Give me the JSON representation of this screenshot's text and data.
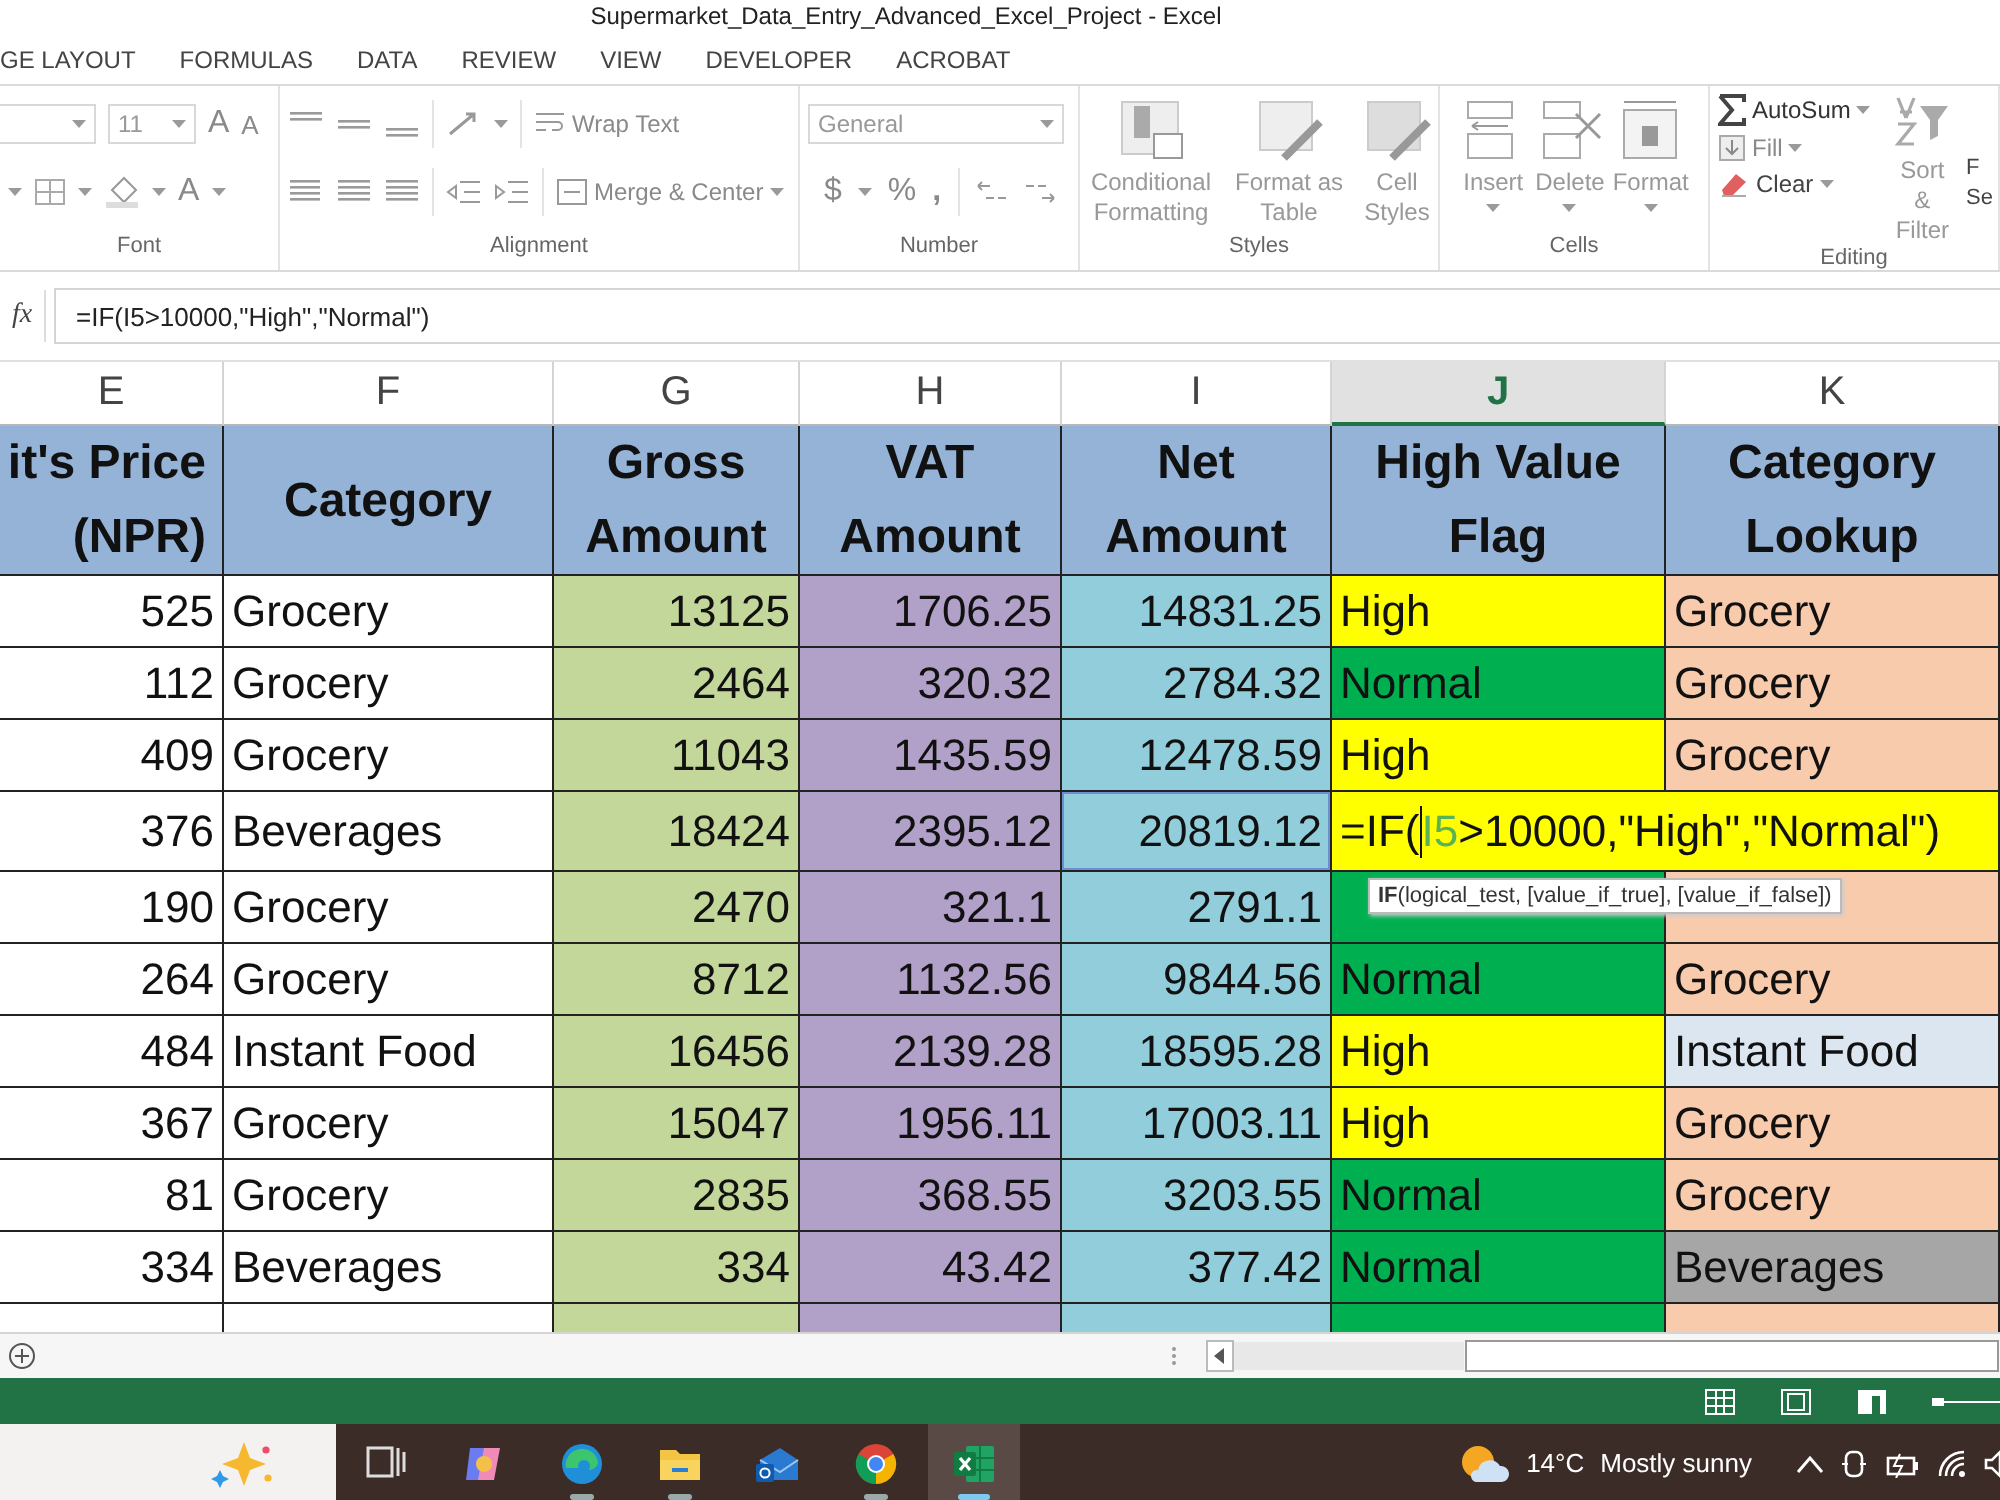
{
  "window": {
    "title": "Supermarket_Data_Entry_Advanced_Excel_Project - Excel"
  },
  "tabs": [
    {
      "label": "GE LAYOUT",
      "selected": false
    },
    {
      "label": "FORMULAS",
      "selected": false
    },
    {
      "label": "DATA",
      "selected": false
    },
    {
      "label": "REVIEW",
      "selected": false
    },
    {
      "label": "VIEW",
      "selected": false
    },
    {
      "label": "DEVELOPER",
      "selected": false
    },
    {
      "label": "ACROBAT",
      "selected": false
    }
  ],
  "ribbon": {
    "groups": [
      {
        "kind": "font",
        "label": "Font",
        "size": "11",
        "grow": "A",
        "shrink": "A",
        "font_color": "A"
      },
      {
        "kind": "alignment",
        "label": "Alignment",
        "wrap": "Wrap Text",
        "merge": "Merge & Center"
      },
      {
        "kind": "number",
        "label": "Number",
        "format": "General",
        "currency": "$",
        "percent": "%",
        "comma": ","
      },
      {
        "kind": "styles",
        "label": "Styles",
        "buttons": [
          "Conditional Formatting",
          "Format as Table",
          "Cell Styles"
        ]
      },
      {
        "kind": "cells",
        "label": "Cells",
        "buttons": [
          "Insert",
          "Delete",
          "Format"
        ]
      },
      {
        "kind": "editing",
        "label": "Editing",
        "autosum": "AutoSum",
        "fill": "Fill",
        "clear": "Clear",
        "sort": "Sort & Filter",
        "find": "F Se"
      }
    ]
  },
  "formula_bar": {
    "function_label": "fx",
    "formula": "=IF(I5>10000,\"High\",\"Normal\")"
  },
  "columns": [
    {
      "label": "E",
      "selected": false
    },
    {
      "label": "F",
      "selected": false
    },
    {
      "label": "G",
      "selected": false
    },
    {
      "label": "H",
      "selected": false
    },
    {
      "label": "I",
      "selected": false
    },
    {
      "label": "J",
      "selected": true
    },
    {
      "label": "K",
      "selected": false
    }
  ],
  "headers": [
    "it's Price (NPR)",
    "Category",
    "Gross Amount",
    "VAT Amount",
    "Net Amount",
    "High Value Flag",
    "Category Lookup"
  ],
  "rows": [
    {
      "kind": "data",
      "price": "525",
      "category": "Grocery",
      "gross": "13125",
      "vat": "1706.25",
      "net": "14831.25",
      "flag": {
        "text": "High",
        "color": "#ffff00"
      },
      "lookup": {
        "text": "Grocery",
        "color": "#f8cbad"
      }
    },
    {
      "kind": "data",
      "price": "112",
      "category": "Grocery",
      "gross": "2464",
      "vat": "320.32",
      "net": "2784.32",
      "flag": {
        "text": "Normal",
        "color": "#00b050"
      },
      "lookup": {
        "text": "Grocery",
        "color": "#f8cbad"
      }
    },
    {
      "kind": "data",
      "price": "409",
      "category": "Grocery",
      "gross": "11043",
      "vat": "1435.59",
      "net": "12478.59",
      "flag": {
        "text": "High",
        "color": "#ffff00"
      },
      "lookup": {
        "text": "Grocery",
        "color": "#f8cbad"
      }
    },
    {
      "kind": "editing",
      "price": "376",
      "category": "Beverages",
      "gross": "18424",
      "vat": "2395.12",
      "net": "20819.12",
      "flag": {
        "color": "#ffff00"
      },
      "formula": [
        {
          "kind": "plain",
          "text": "=IF("
        },
        {
          "kind": "ref",
          "text": "I5"
        },
        {
          "kind": "plain",
          "text": ">10000,\"High\",\"Normal\")"
        }
      ],
      "tooltip": "**IF**(logical_test, [value_if_true], [value_if_false])"
    },
    {
      "kind": "data",
      "price": "190",
      "category": "Grocery",
      "gross": "2470",
      "vat": "321.1",
      "net": "2791.1",
      "flag": {
        "color": "#00b050"
      },
      "lookup": {
        "color": "#f8cbad"
      }
    },
    {
      "kind": "data",
      "price": "264",
      "category": "Grocery",
      "gross": "8712",
      "vat": "1132.56",
      "net": "9844.56",
      "flag": {
        "text": "Normal",
        "color": "#00b050"
      },
      "lookup": {
        "text": "Grocery",
        "color": "#f8cbad"
      }
    },
    {
      "kind": "data",
      "price": "484",
      "category": "Instant Food",
      "gross": "16456",
      "vat": "2139.28",
      "net": "18595.28",
      "flag": {
        "text": "High",
        "color": "#ffff00"
      },
      "lookup": {
        "text": "Instant Food",
        "color": "#dce6f1"
      }
    },
    {
      "kind": "data",
      "price": "367",
      "category": "Grocery",
      "gross": "15047",
      "vat": "1956.11",
      "net": "17003.11",
      "flag": {
        "text": "High",
        "color": "#ffff00"
      },
      "lookup": {
        "text": "Grocery",
        "color": "#f8cbad"
      }
    },
    {
      "kind": "data",
      "price": "81",
      "category": "Grocery",
      "gross": "2835",
      "vat": "368.55",
      "net": "3203.55",
      "flag": {
        "text": "Normal",
        "color": "#00b050"
      },
      "lookup": {
        "text": "Grocery",
        "color": "#f8cbad"
      }
    },
    {
      "kind": "data",
      "price": "334",
      "category": "Beverages",
      "gross": "334",
      "vat": "43.42",
      "net": "377.42",
      "flag": {
        "text": "Normal",
        "color": "#00b050"
      },
      "lookup": {
        "text": "Beverages",
        "color": "#a6a6a6"
      }
    },
    {
      "kind": "cut",
      "flag": {
        "color": "#00b050"
      },
      "lookup": {
        "color": "#f8cbad"
      }
    }
  ],
  "taskbar": {
    "apps": [
      {
        "kind": "taskview",
        "selected": false,
        "running": false
      },
      {
        "kind": "copilot",
        "selected": false,
        "running": false
      },
      {
        "kind": "edge",
        "selected": false,
        "running": true
      },
      {
        "kind": "files",
        "selected": false,
        "running": true
      },
      {
        "kind": "outlook",
        "selected": false,
        "running": false
      },
      {
        "kind": "chrome",
        "selected": false,
        "running": true
      },
      {
        "kind": "excel",
        "selected": true,
        "running": true
      }
    ],
    "weather": {
      "temp": "14°C",
      "text": "Mostly sunny"
    }
  }
}
